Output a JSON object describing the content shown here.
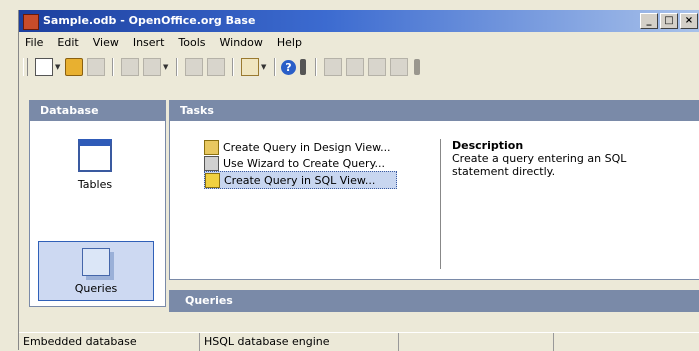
{
  "window": {
    "title": "Sample.odb - OpenOffice.org Base",
    "buttons": [
      "_",
      "□",
      "×"
    ]
  },
  "menu": [
    "File",
    "Edit",
    "View",
    "Insert",
    "Tools",
    "Window",
    "Help"
  ],
  "database": {
    "header": "Database",
    "items": [
      {
        "label": "Tables",
        "icon": "tables-icon",
        "selected": false
      },
      {
        "label": "Queries",
        "icon": "queries-icon",
        "selected": true
      }
    ]
  },
  "tasks": {
    "header": "Tasks",
    "items": [
      {
        "label": "Create Query in Design View...",
        "icon": "design-view-icon",
        "selected": false
      },
      {
        "label": "Use Wizard to Create Query...",
        "icon": "wizard-icon",
        "selected": false
      },
      {
        "label": "Create Query in SQL View...",
        "icon": "sql-view-icon",
        "selected": true
      }
    ],
    "description_title": "Description",
    "description_text": "Create a query  entering an SQL statement directly."
  },
  "queries": {
    "header": "Queries"
  },
  "status": {
    "left": "Embedded database",
    "right": "HSQL database engine"
  },
  "colors": {
    "header_bg": "#7a8aa8",
    "selection_bg": "#c8d6f0",
    "title_start": "#1c3f9e",
    "title_end": "#a9c2ea"
  }
}
